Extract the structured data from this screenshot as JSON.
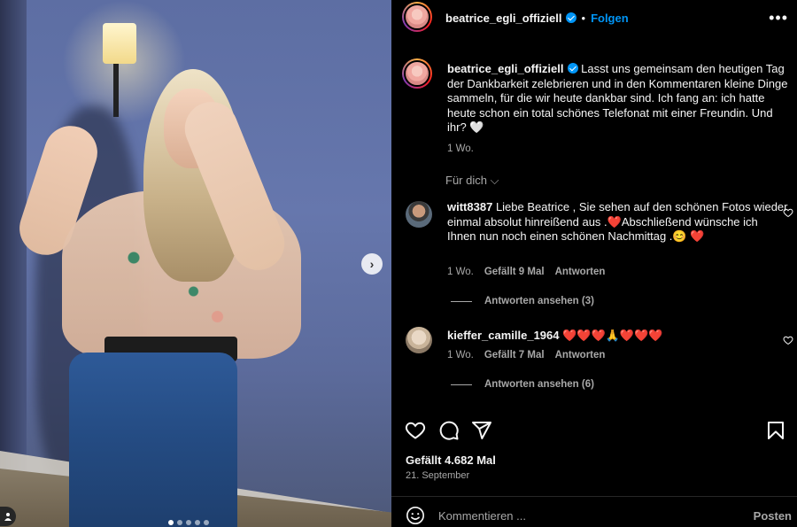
{
  "post": {
    "author": "beatrice_egli_offiziell",
    "follow_label": "Folgen",
    "separator": "•",
    "more_label": "•••",
    "caption": "Lasst uns gemeinsam den heutigen Tag der Dankbarkeit zelebrieren und in den Kommentaren kleine Dinge sammeln, für die wir heute dankbar sind. Ich fang an: ich hatte heute schon ein total schönes Telefonat mit einer Freundin. Und ihr? 🤍",
    "caption_time": "1 Wo.",
    "sort_label": "Für dich ⌵",
    "likes": "Gefällt 4.682 Mal",
    "date": "21. September",
    "comment_placeholder": "Kommentieren ...",
    "post_label": "Posten",
    "carousel_index": 1,
    "carousel_count": 5
  },
  "comments": [
    {
      "user": "witt8387",
      "text": "Liebe Beatrice , Sie sehen auf den schönen Fotos wieder einmal absolut hinreißend aus .❤️Abschließend wünsche ich Ihnen nun noch einen schönen Nachmittag .😊 ❤️",
      "time": "1 Wo.",
      "likes": "Gefällt 9 Mal",
      "reply_label": "Antworten",
      "view_replies": "Antworten ansehen (3)"
    },
    {
      "user": "kieffer_camille_1964",
      "text": "❤️❤️❤️🙏❤️❤️❤️",
      "time": "1 Wo.",
      "likes": "Gefällt 7 Mal",
      "reply_label": "Antworten",
      "view_replies": "Antworten ansehen (6)"
    }
  ],
  "colors": {
    "accent": "#0095f6",
    "background": "#000000",
    "muted": "#a8a8a8",
    "text": "#f5f5f5"
  },
  "icons": [
    "heart-icon",
    "comment-icon",
    "share-icon",
    "bookmark-icon",
    "emoji-icon",
    "more-icon",
    "verified-icon",
    "next-icon",
    "user-tag-icon"
  ]
}
